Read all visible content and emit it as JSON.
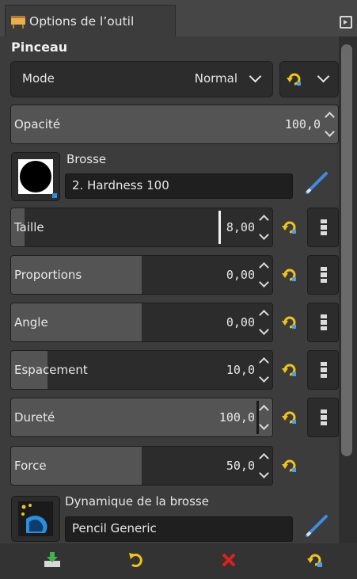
{
  "tab": {
    "title": "Options de l’outil"
  },
  "tool": {
    "name": "Pinceau"
  },
  "mode": {
    "label": "Mode",
    "value": "Normal"
  },
  "opacity": {
    "label": "Opacité",
    "value": "100,0"
  },
  "brush": {
    "label": "Brosse",
    "name": "2. Hardness 100"
  },
  "sliders": [
    {
      "label": "Taille",
      "value": "8,00",
      "fill": 0.05
    },
    {
      "label": "Proportions",
      "value": "0,00",
      "fill": 0.5
    },
    {
      "label": "Angle",
      "value": "0,00",
      "fill": 0.5
    },
    {
      "label": "Espacement",
      "value": "10,0",
      "fill": 0.14
    },
    {
      "label": "Dureté",
      "value": "100,0",
      "fill": 1.0
    },
    {
      "label": "Force",
      "value": "50,0",
      "fill": 0.5
    }
  ],
  "dynamics": {
    "label": "Dynamique de la brosse",
    "name": "Pencil Generic"
  },
  "colors": {
    "accent": "#f2c318",
    "fill": "#545454",
    "field": "#2c2c2c",
    "delete": "#e02020",
    "save": "#3cb44a"
  },
  "bottom": {
    "icons": [
      "save-icon",
      "restore-icon",
      "delete-icon",
      "reset-icon"
    ]
  }
}
